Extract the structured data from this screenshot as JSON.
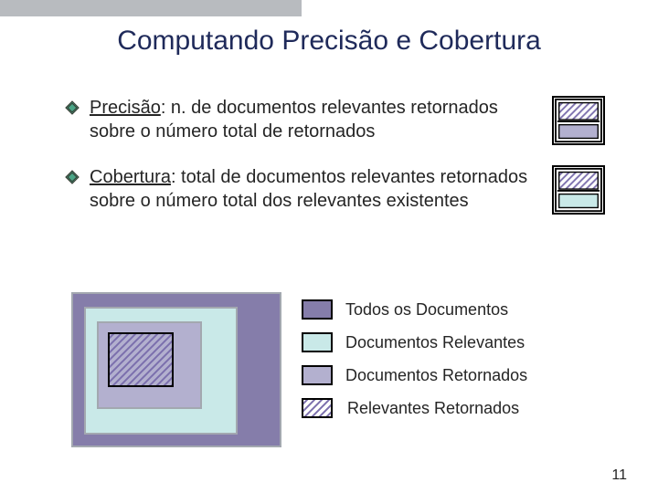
{
  "title": "Computando Precisão e Cobertura",
  "bullets": {
    "precision": {
      "term": "Precisão",
      "rest": ": n. de documentos relevantes retornados sobre o número total de retornados"
    },
    "recall": {
      "term": "Cobertura",
      "rest": ": total de documentos relevantes retornados sobre o número total dos relevantes existentes"
    }
  },
  "legend": {
    "all": "Todos os Documentos",
    "relevant": "Documentos Relevantes",
    "returned": "Documentos Retornados",
    "relret": "Relevantes Retornados"
  },
  "colors": {
    "all": "#857daa",
    "relevant": "#c9e9e8",
    "returned": "#b3b0cf",
    "hatch": "#7b6fad",
    "title": "#1f2a5a"
  },
  "page_number": "11"
}
